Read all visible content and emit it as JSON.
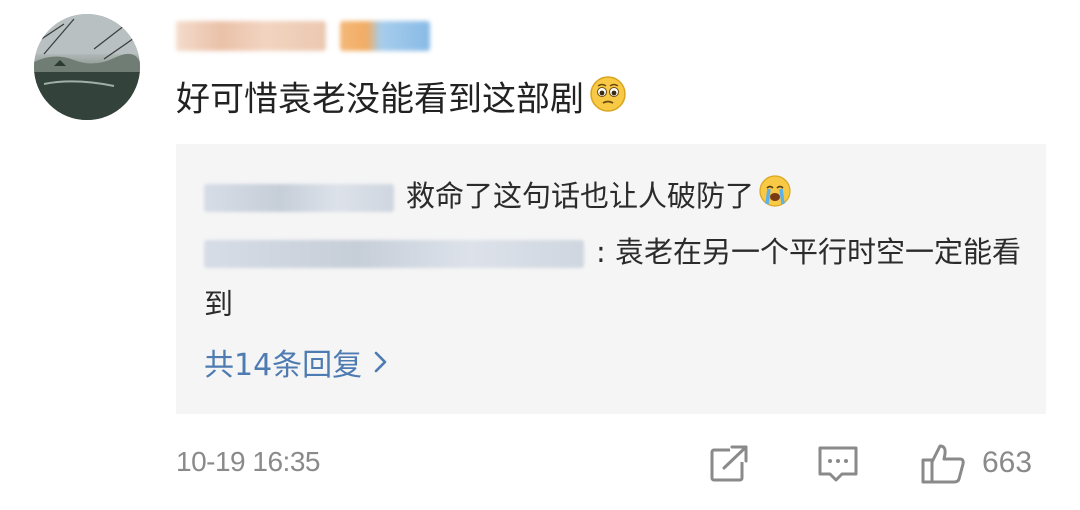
{
  "comment": {
    "text": "好可惜袁老没能看到这部剧"
  },
  "replies": [
    {
      "text": "救命了这句话也让人破防了"
    },
    {
      "text": ": 袁老在另一个平行时空一定能看到"
    }
  ],
  "more_replies_label": "共14条回复",
  "footer": {
    "timestamp": "10-19 16:35",
    "like_count": "663"
  },
  "colors": {
    "link": "#4d7bb2",
    "muted": "#8a8a8a",
    "reply_bg": "#f5f5f5"
  },
  "icons": {
    "comment_emoji": "sad-face-icon",
    "reply_emoji": "crying-face-icon",
    "more": "chevron-right-icon",
    "share": "share-icon",
    "comment": "comment-icon",
    "like": "thumbs-up-icon"
  }
}
